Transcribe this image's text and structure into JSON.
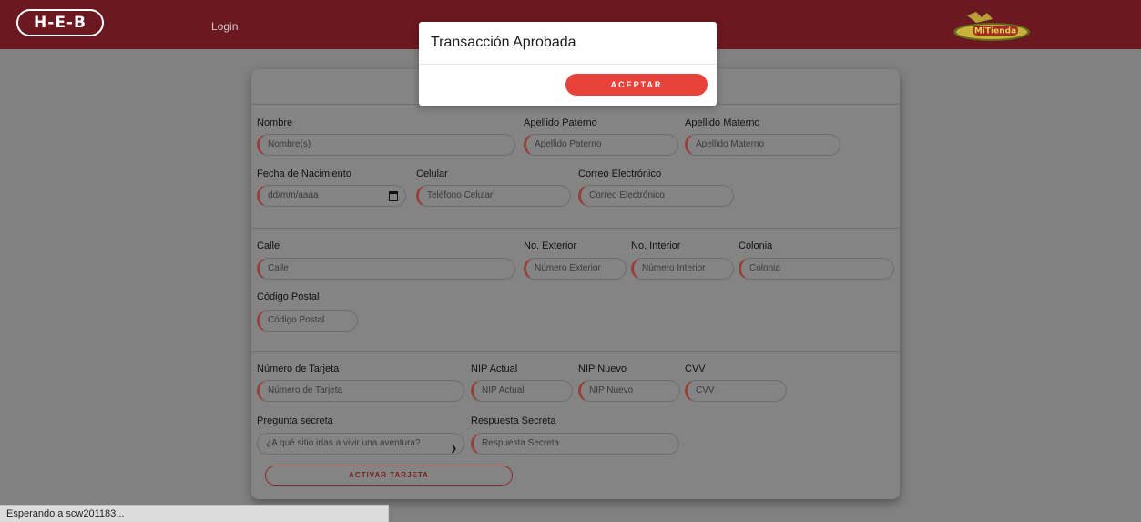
{
  "header": {
    "logo_text": "H-E-B",
    "login_label": "Login",
    "brand_logo_text": "MiTienda"
  },
  "form": {
    "personal": {
      "nombre_label": "Nombre",
      "nombre_placeholder": "Nombre(s)",
      "paterno_label": "Apellido Paterno",
      "paterno_placeholder": "Apellido Paterno",
      "materno_label": "Apellido Materno",
      "materno_placeholder": "Apellido Materno",
      "fecha_label": "Fecha de Nacimiento",
      "fecha_placeholder": "dd/mm/aaaa",
      "celular_label": "Celular",
      "celular_placeholder": "Teléfono Celular",
      "correo_label": "Correo Electrónico",
      "correo_placeholder": "Correo Electrónico"
    },
    "address": {
      "calle_label": "Calle",
      "calle_placeholder": "Calle",
      "exterior_label": "No. Exterior",
      "exterior_placeholder": "Número Exterior",
      "interior_label": "No. Interior",
      "interior_placeholder": "Número Interior",
      "colonia_label": "Colonia",
      "colonia_placeholder": "Colonia",
      "cp_label": "Código Postal",
      "cp_placeholder": "Código Postal"
    },
    "card": {
      "tarjeta_label": "Número de Tarjeta",
      "tarjeta_placeholder": "Número de Tarjeta",
      "nip_actual_label": "NIP Actual",
      "nip_actual_placeholder": "NIP Actual",
      "nip_nuevo_label": "NIP Nuevo",
      "nip_nuevo_placeholder": "NIP Nuevo",
      "cvv_label": "CVV",
      "cvv_placeholder": "CVV",
      "pregunta_label": "Pregunta secreta",
      "pregunta_value": "¿A qué sitio irías a vivir una aventura?",
      "respuesta_label": "Respuesta Secreta",
      "respuesta_placeholder": "Respuesta Secreta",
      "activate_label": "ACTIVAR TARJETA"
    }
  },
  "modal": {
    "title": "Transacción Aprobada",
    "accept_label": "ACEPTAR"
  },
  "status_bar": {
    "text": "Esperando a scw201183..."
  },
  "colors": {
    "header_bg": "#6b1820",
    "accent_red": "#e8433a",
    "overlay_gray": "#818181"
  }
}
